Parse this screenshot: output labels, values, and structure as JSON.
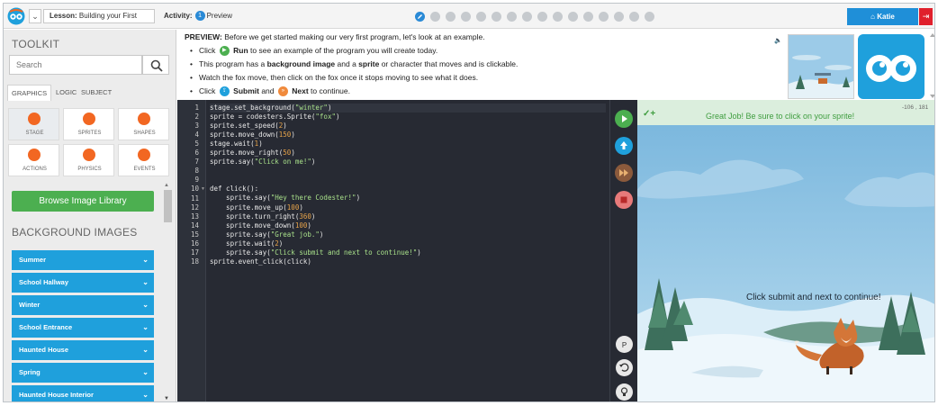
{
  "header": {
    "lesson_label": "Lesson:",
    "lesson_name": "Building your First",
    "activity_label": "Activity:",
    "activity_number": "1",
    "activity_name": "Preview",
    "progress_steps": 16,
    "progress_current": 1,
    "user_name": "Katie",
    "colors": {
      "accent": "#1f8fd8",
      "logout": "#e0202c"
    }
  },
  "toolkit": {
    "title": "TOOLKIT",
    "search_placeholder": "Search",
    "tabs": [
      "GRAPHICS",
      "LOGIC",
      "SUBJECT"
    ],
    "tiles": [
      "STAGE",
      "SPRITES",
      "SHAPES",
      "ACTIONS",
      "PHYSICS",
      "EVENTS"
    ],
    "browse_label": "Browse Image Library",
    "bg_heading": "BACKGROUND IMAGES",
    "bg_items": [
      "Summer",
      "School Hallway",
      "Winter",
      "School Entrance",
      "Haunted House",
      "Spring",
      "Haunted House Interior"
    ]
  },
  "preview": {
    "intro_bold": "PREVIEW:",
    "intro_text": " Before we get started making our very first program, let's look at an example.",
    "b1_pre": "Click ",
    "b1_bold": "Run",
    "b1_post": " to see an example of the program you will create today.",
    "b2_pre": "This program has a ",
    "b2_bold1": "background image",
    "b2_mid": " and a ",
    "b2_bold2": "sprite",
    "b2_post": " or character that moves and is clickable.",
    "b3": "Watch the fox move, then click on the fox once it stops moving to see what it does.",
    "b4_pre": "Click ",
    "b4_bold1": "Submit",
    "b4_mid": " and ",
    "b4_bold2": "Next",
    "b4_post": " to continue."
  },
  "editor": {
    "lines": [
      "stage.set_background(\"winter\")",
      "sprite = codesters.Sprite(\"fox\")",
      "sprite.set_speed(2)",
      "sprite.move_down(150)",
      "stage.wait(1)",
      "sprite.move_right(50)",
      "sprite.say(\"Click on me!\")",
      "",
      "",
      "def click():",
      "    sprite.say(\"Hey there Codester!\")",
      "    sprite.move_up(100)",
      "    sprite.turn_right(360)",
      "    sprite.move_down(100)",
      "    sprite.say(\"Great job.\")",
      "    sprite.wait(2)",
      "    sprite.say(\"Click submit and next to continue!\")",
      "sprite.event_click(click)"
    ]
  },
  "stage": {
    "check_icon": "✓+",
    "message": "Great Job! Be sure to click on your sprite!",
    "coords": "-106 , 181",
    "say_text": "Click submit and next to continue!"
  }
}
